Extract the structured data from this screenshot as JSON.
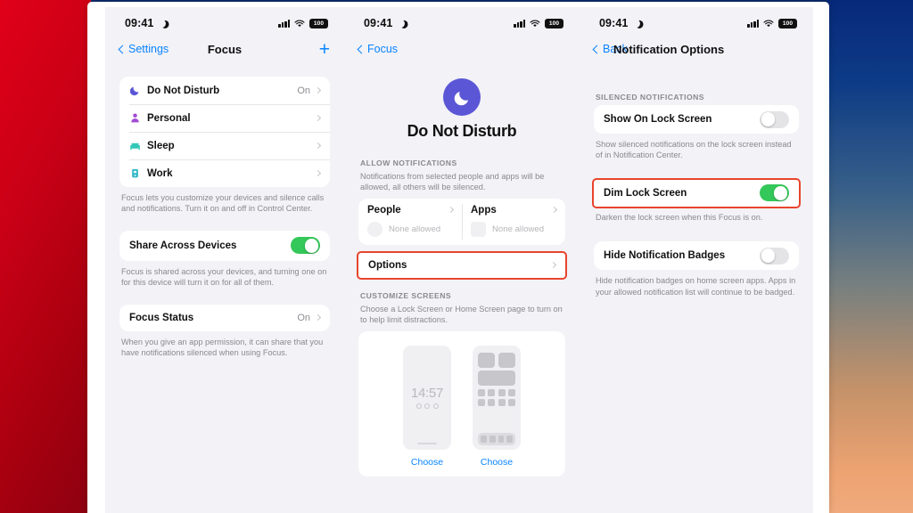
{
  "background": {
    "left_gradient": "#c90016",
    "right_gradient_top": "#08297a",
    "right_gradient_bottom": "#f0aa7c"
  },
  "highlight_color": "#e8452c",
  "accent_blue": "#0a84ff",
  "toggle_on_color": "#34c759",
  "status_bar": {
    "time": "09:41",
    "moon_icon": "crescent-moon-icon",
    "signal_icon": "cellular-signal-icon",
    "wifi_icon": "wifi-icon",
    "battery_label": "100"
  },
  "panel_focus_list": {
    "nav": {
      "back_label": "Settings",
      "title": "Focus",
      "add_label": "+"
    },
    "focus_modes": [
      {
        "label": "Do Not Disturb",
        "value": "On",
        "icon": "moon-icon",
        "icon_color": "#5a56d6"
      },
      {
        "label": "Personal",
        "value": "",
        "icon": "person-icon",
        "icon_color": "#a24bd6"
      },
      {
        "label": "Sleep",
        "value": "",
        "icon": "bed-icon",
        "icon_color": "#32c7b7"
      },
      {
        "label": "Work",
        "value": "",
        "icon": "briefcase-icon",
        "icon_color": "#32b7c7"
      }
    ],
    "focus_modes_footnote": "Focus lets you customize your devices and silence calls and notifications. Turn it on and off in Control Center.",
    "share_across_devices": {
      "label": "Share Across Devices",
      "state": "on",
      "footnote": "Focus is shared across your devices, and turning one on for this device will turn it on for all of them."
    },
    "focus_status": {
      "label": "Focus Status",
      "value": "On",
      "footnote": "When you give an app permission, it can share that you have notifications silenced when using Focus."
    }
  },
  "panel_dnd": {
    "nav": {
      "back_label": "Focus"
    },
    "hero": {
      "title": "Do Not Disturb",
      "icon": "moon-icon",
      "circle_color": "#5a56d6"
    },
    "allow_notifications": {
      "header": "ALLOW NOTIFICATIONS",
      "subtitle": "Notifications from selected people and apps will be allowed, all others will be silenced.",
      "people": {
        "label": "People",
        "placeholder_text": "None allowed"
      },
      "apps": {
        "label": "Apps",
        "placeholder_text": "None allowed"
      },
      "options": {
        "label": "Options",
        "highlighted": true
      }
    },
    "customize_screens": {
      "header": "CUSTOMIZE SCREENS",
      "subtitle": "Choose a Lock Screen or Home Screen page to turn on to help limit distractions.",
      "lock_preview": {
        "time": "14:57",
        "choose_label": "Choose"
      },
      "home_preview": {
        "choose_label": "Choose"
      }
    }
  },
  "panel_notification_options": {
    "nav": {
      "back_label": "Back",
      "title": "Notification Options"
    },
    "section_header": "SILENCED NOTIFICATIONS",
    "rows": [
      {
        "label": "Show On Lock Screen",
        "state": "off",
        "highlighted": false,
        "footnote": "Show silenced notifications on the lock screen instead of in Notification Center."
      },
      {
        "label": "Dim Lock Screen",
        "state": "on",
        "highlighted": true,
        "footnote": "Darken the lock screen when this Focus is on."
      },
      {
        "label": "Hide Notification Badges",
        "state": "off",
        "highlighted": false,
        "footnote": "Hide notification badges on home screen apps. Apps in your allowed notification list will continue to be badged."
      }
    ]
  }
}
